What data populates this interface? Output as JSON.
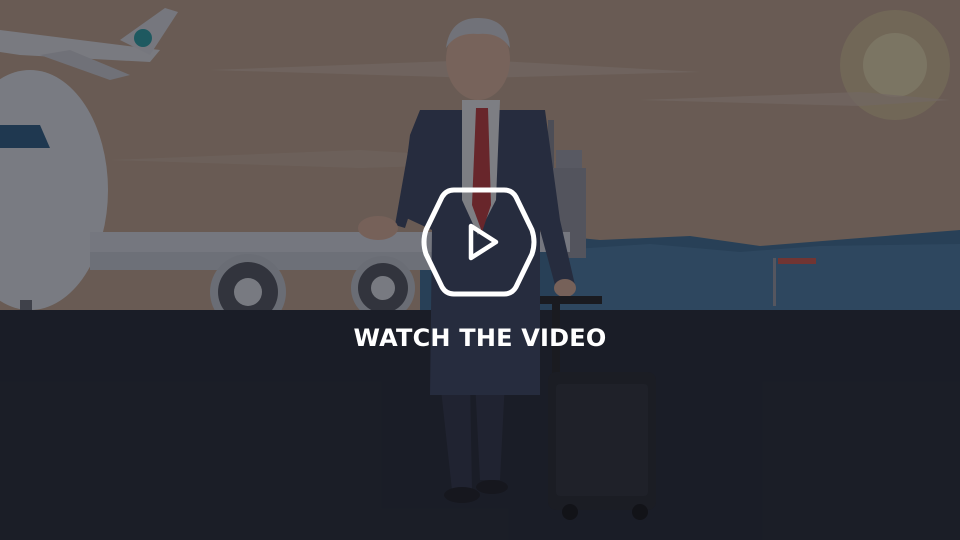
{
  "video": {
    "cta_label": "WATCH THE VIDEO"
  },
  "icons": {
    "play": "play-icon",
    "play_frame": "hexagon-frame"
  },
  "colors": {
    "sky": "#b79a82",
    "ground": "#1f222b",
    "overlay": "#14161e",
    "tie": "#c43a3a",
    "mountains": "#3f6f94",
    "text": "#ffffff"
  }
}
